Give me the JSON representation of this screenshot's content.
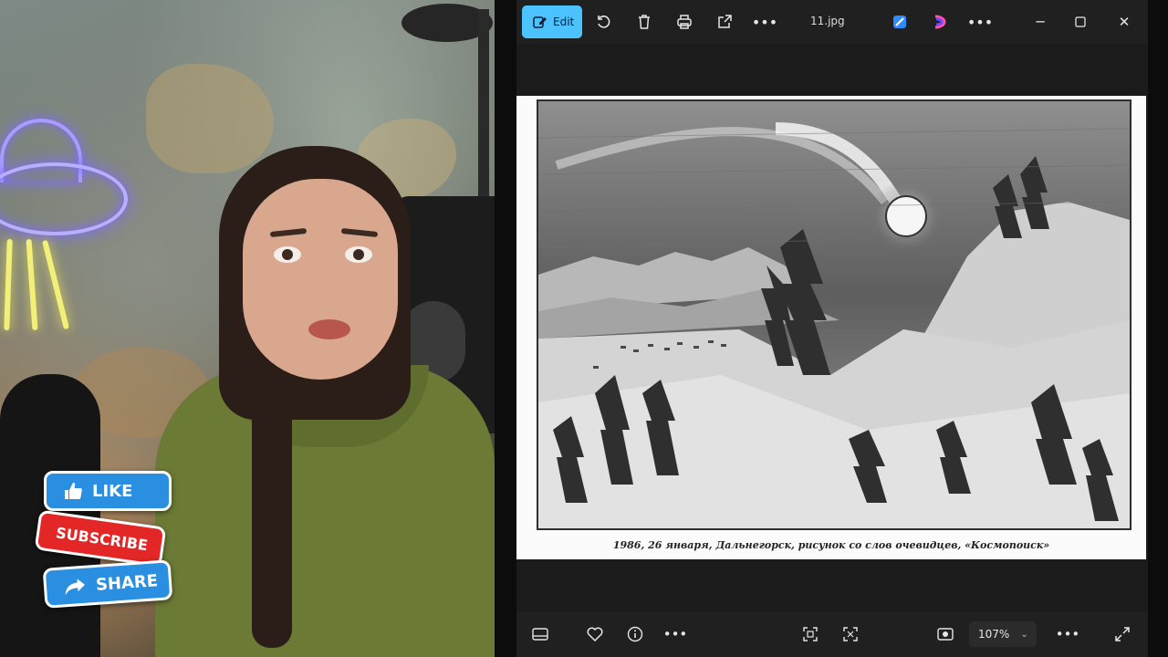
{
  "social": {
    "like": "LIKE",
    "subscribe": "SUBSCRIBE",
    "share": "SHARE"
  },
  "viewer": {
    "edit_label": "Edit",
    "file_name": "11.jpg",
    "caption": "1986, 26 января, Дальнегорск, рисунок со слов очевидцев, «Космопоиск»",
    "zoom": "107%",
    "icons": {
      "rotate": "rotate-icon",
      "delete": "trash-icon",
      "print": "print-icon",
      "share": "share-icon",
      "more": "more-icon",
      "designer": "designer-icon",
      "clipchamp": "clipchamp-icon",
      "filmstrip": "filmstrip-icon",
      "favorite": "heart-icon",
      "info": "info-icon",
      "fit": "fit-to-window-icon",
      "actual": "actual-size-icon",
      "slideshow": "slideshow-icon",
      "fullscreen": "fullscreen-icon"
    },
    "accent": "#4cc2ff"
  }
}
